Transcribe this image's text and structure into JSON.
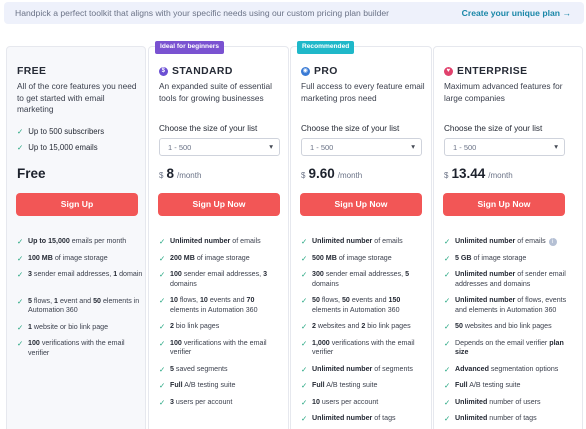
{
  "banner": {
    "text": "Handpick a perfect toolkit that aligns with your specific needs using our custom pricing plan builder",
    "link": "Create your unique plan →"
  },
  "check_glyph": "✓",
  "plans": [
    {
      "name": "FREE",
      "description": "All of the core features you need to get started with email marketing",
      "quick_features": [
        "Up to 500 subscribers",
        "Up to 15,000 emails"
      ],
      "price": "Free",
      "cta": "Sign Up",
      "features": [
        "<b>Up to 15,000</b> emails per month",
        "<b>100 MB</b> of image storage",
        "<b>3</b> sender email addresses, <b>1</b> domain",
        "<b>5</b> flows, <b>1</b> event and <b>50</b> elements in Automation 360",
        "<b>1</b> website or bio link page",
        "<b>100</b> verifications with the email verifier"
      ]
    },
    {
      "badge": "Ideal for beginners",
      "badge_color": "#7a52d1",
      "icon": "standard-plan-icon",
      "name": "STANDARD",
      "description": "An expanded suite of essential tools for growing businesses",
      "choose_label": "Choose the size of your list",
      "select_value": "1 - 500",
      "currency": "$",
      "price": "8",
      "period": "/month",
      "cta": "Sign Up Now",
      "features": [
        "<b>Unlimited number</b> of emails",
        "<b>200 MB</b> of image storage",
        "<b>100</b> sender email addresses, <b>3</b> domains",
        "<b>10</b> flows, <b>10</b> events and <b>70</b> elements in Automation 360",
        "<b>2</b> bio link pages",
        "<b>100</b> verifications with the email verifier",
        "<b>5</b> saved segments",
        "<b>Full</b> A/B testing suite",
        "<b>3</b> users per account"
      ]
    },
    {
      "badge": "Recommended",
      "badge_color": "#1fb8c9",
      "icon": "pro-plan-icon",
      "name": "PRO",
      "description": "Full access to every feature email marketing pros need",
      "choose_label": "Choose the size of your list",
      "select_value": "1 - 500",
      "currency": "$",
      "price": "9.60",
      "period": "/month",
      "cta": "Sign Up Now",
      "features": [
        "<b>Unlimited number</b> of emails",
        "<b>500 MB</b> of image storage",
        "<b>300</b> sender email addresses, <b>5</b> domains",
        "<b>50</b> flows, <b>50</b> events and <b>150</b> elements in Automation 360",
        "<b>2</b> websites and <b>2</b> bio link pages",
        "<b>1,000</b> verifications with the email verifier",
        "<b>Unlimited number</b> of segments",
        "<b>Full</b> A/B testing suite",
        "<b>10</b> users per account",
        "<b>Unlimited number</b> of tags"
      ]
    },
    {
      "icon": "enterprise-plan-icon",
      "name": "ENTERPRISE",
      "description": "Maximum advanced features for large companies",
      "choose_label": "Choose the size of your list",
      "select_value": "1 - 500",
      "currency": "$",
      "price": "13.44",
      "period": "/month",
      "cta": "Sign Up Now",
      "features": [
        "<b>Unlimited number</b> of emails",
        "<b>5 GB</b> of image storage",
        "<b>Unlimited number</b> of sender email addresses and domains",
        "<b>Unlimited number</b> of flows, events and elements in Automation 360",
        "<b>50</b> websites and bio link pages",
        "Depends on the email verifier <b>plan size</b>",
        "<b>Advanced</b> segmentation options",
        "<b>Full</b> A/B testing suite",
        "<b>Unlimited</b> number of users",
        "<b>Unlimited</b> number of tags"
      ]
    }
  ]
}
